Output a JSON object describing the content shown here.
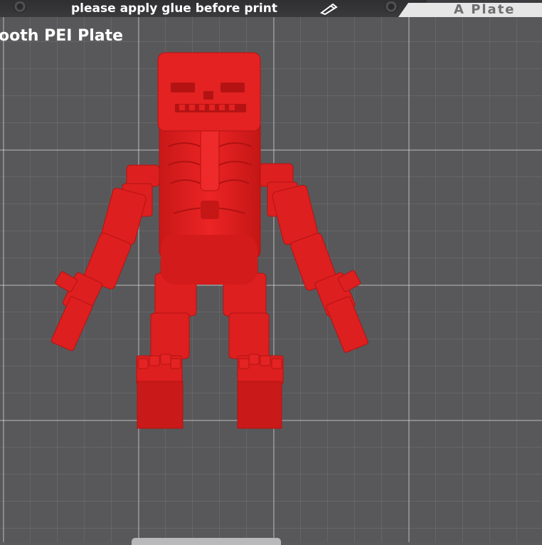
{
  "header": {
    "notice": "please apply glue before print",
    "plate_tab_label": "A Plate",
    "edit_icon": "pencil-icon"
  },
  "plate": {
    "name": "ooth PEI Plate"
  },
  "model": {
    "description_icon": "skeleton-model",
    "color": "#e52222"
  },
  "colors": {
    "model_red": "#e52222",
    "model_dark": "#b81515",
    "bed": "#58585a",
    "grid": "#bdbdbd"
  }
}
